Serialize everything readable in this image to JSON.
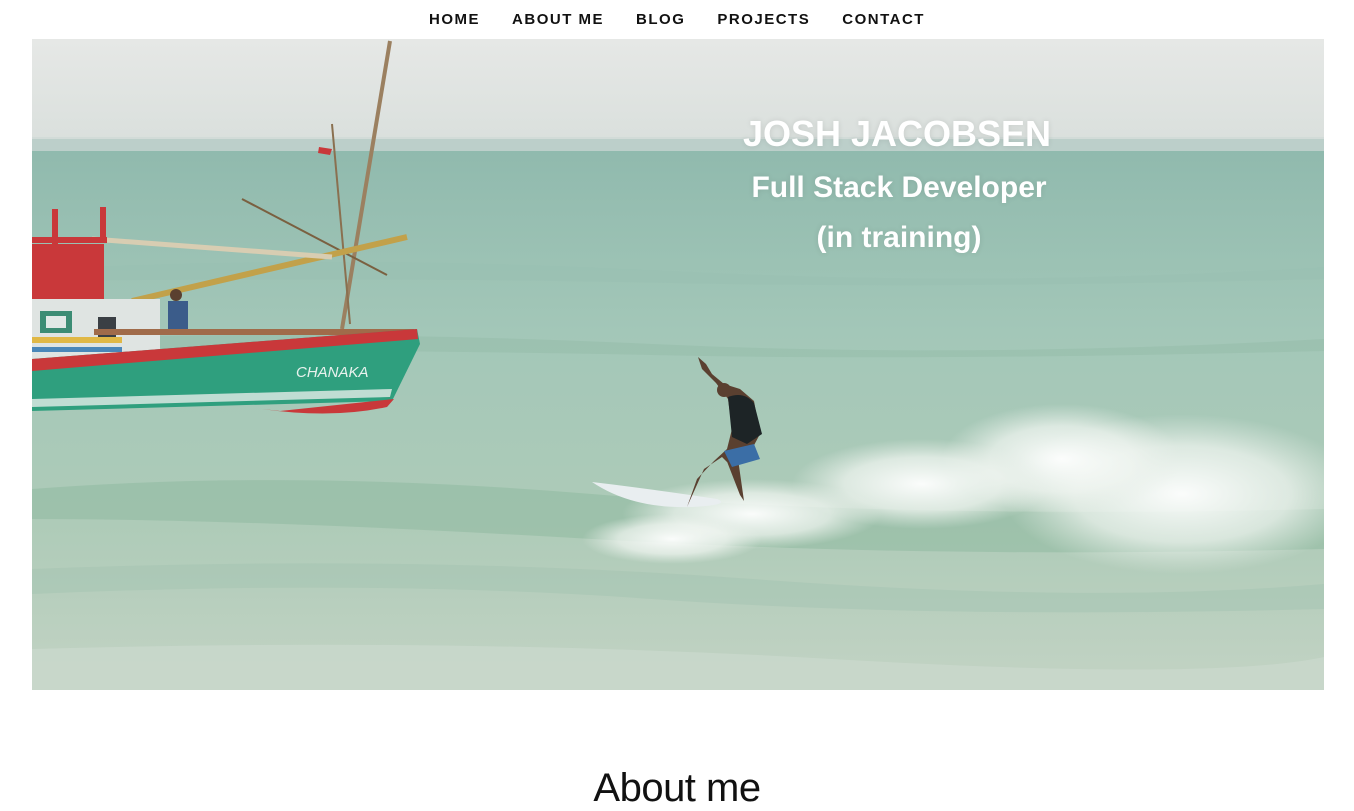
{
  "nav": {
    "items": [
      {
        "label": "HOME"
      },
      {
        "label": "ABOUT ME"
      },
      {
        "label": "BLOG"
      },
      {
        "label": "PROJECTS"
      },
      {
        "label": "CONTACT"
      }
    ]
  },
  "hero": {
    "name": "JOSH JACOBSEN",
    "role": "Full Stack Developer",
    "subtitle": "(in training)",
    "boat_name": "CHANAKA"
  },
  "about": {
    "title": "About me"
  },
  "colors": {
    "nav_text": "#111111",
    "hero_text": "#ffffff",
    "sea": "#9dc4b4",
    "sky": "#e3e6e4",
    "boat_hull": "#2f9f7e",
    "boat_trim": "#c9383a"
  }
}
